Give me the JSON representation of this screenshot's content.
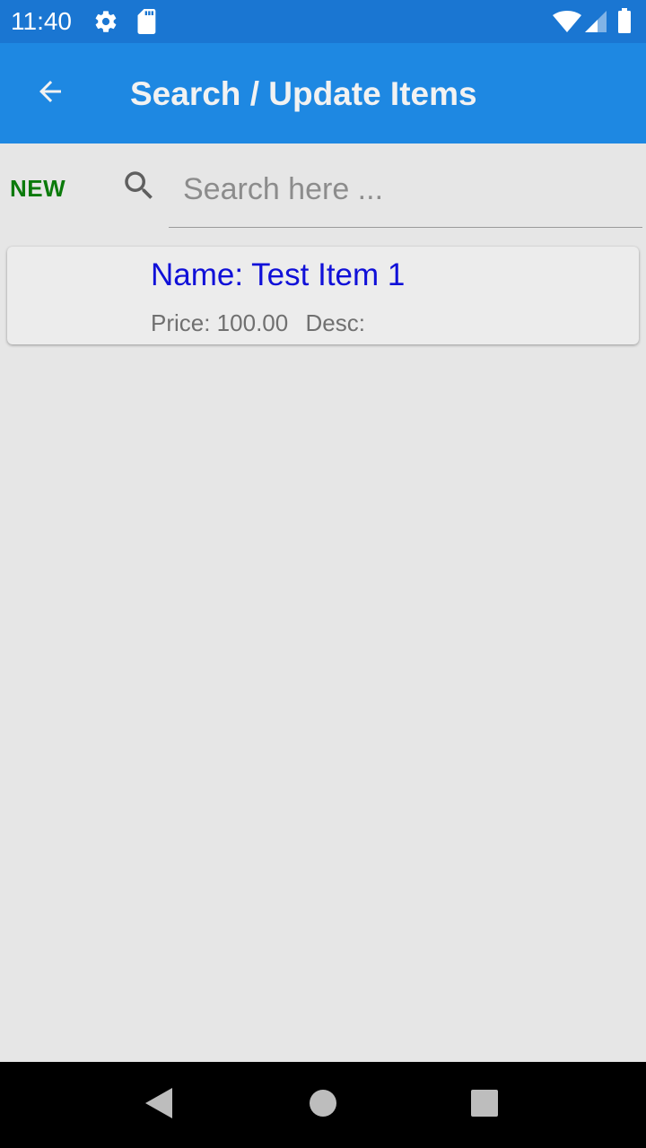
{
  "status_bar": {
    "time": "11:40",
    "icons": [
      "gear-icon",
      "sd-card-icon",
      "wifi-icon",
      "signal-icon",
      "battery-icon"
    ],
    "color": "#1a76d2"
  },
  "app_bar": {
    "title": "Search / Update Items",
    "back_icon": "arrow-left-icon",
    "color": "#1e88e2"
  },
  "search": {
    "new_label": "NEW",
    "new_color": "#0b7a0b",
    "placeholder": "Search here ...",
    "value": ""
  },
  "items": [
    {
      "name": "Name: Test Item 1",
      "price": "Price: 100.00",
      "desc": "Desc:"
    }
  ],
  "nav_bar": {
    "buttons": [
      "back-triangle-icon",
      "home-circle-icon",
      "recents-square-icon"
    ]
  }
}
